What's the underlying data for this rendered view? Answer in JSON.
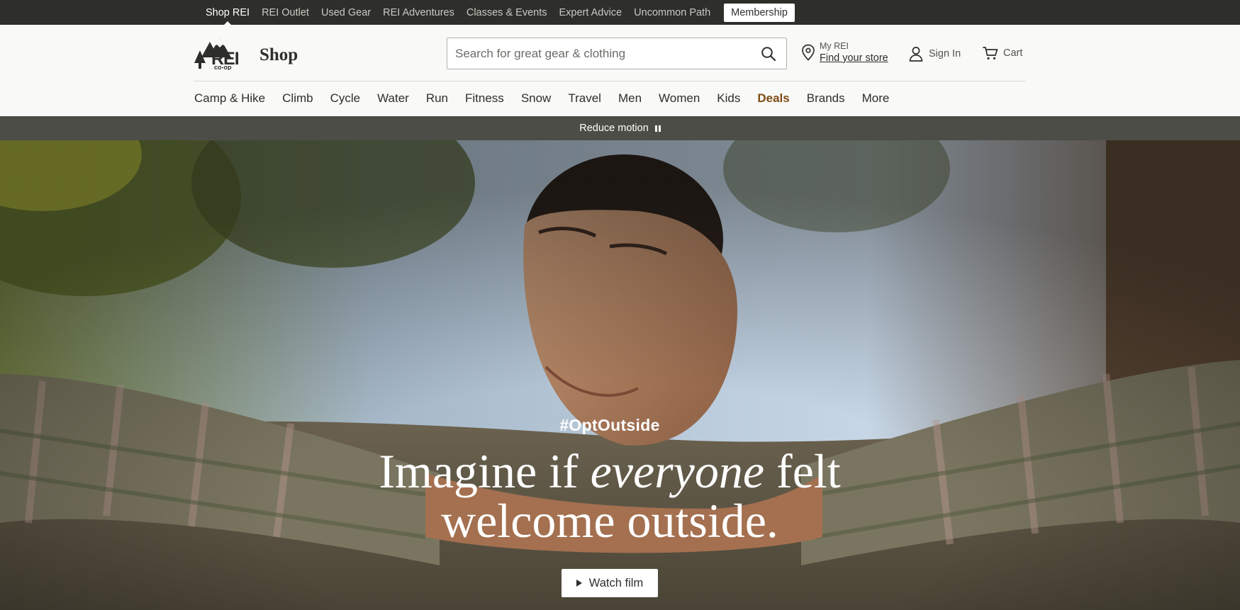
{
  "topbar": {
    "links": [
      "Shop REI",
      "REI Outlet",
      "Used Gear",
      "REI Adventures",
      "Classes & Events",
      "Expert Advice",
      "Uncommon Path"
    ],
    "active": "Shop REI",
    "membership_label": "Membership"
  },
  "header": {
    "logo_text": "REI co-op",
    "shop_label": "Shop",
    "search": {
      "placeholder": "Search for great gear & clothing",
      "value": ""
    },
    "store": {
      "small_label": "My REI",
      "link_label": "Find your store"
    },
    "signin_label": "Sign In",
    "cart_label": "Cart"
  },
  "nav": {
    "items": [
      "Camp & Hike",
      "Climb",
      "Cycle",
      "Water",
      "Run",
      "Fitness",
      "Snow",
      "Travel",
      "Men",
      "Women",
      "Kids",
      "Deals",
      "Brands",
      "More"
    ]
  },
  "motion": {
    "label": "Reduce motion"
  },
  "hero": {
    "hashtag": "#OptOutside",
    "headline_part1": "Imagine if ",
    "headline_em": "everyone",
    "headline_part2": " felt",
    "headline_line2": "welcome outside.",
    "cta_label": "Watch film"
  },
  "colors": {
    "topbar_bg": "#2e2e2b",
    "header_bg": "#f9f9f7",
    "deals": "#7d4b15",
    "motion_bar": "#4d4d48"
  },
  "icons": [
    "search-icon",
    "location-pin-icon",
    "user-icon",
    "cart-icon",
    "pause-icon",
    "play-icon"
  ]
}
